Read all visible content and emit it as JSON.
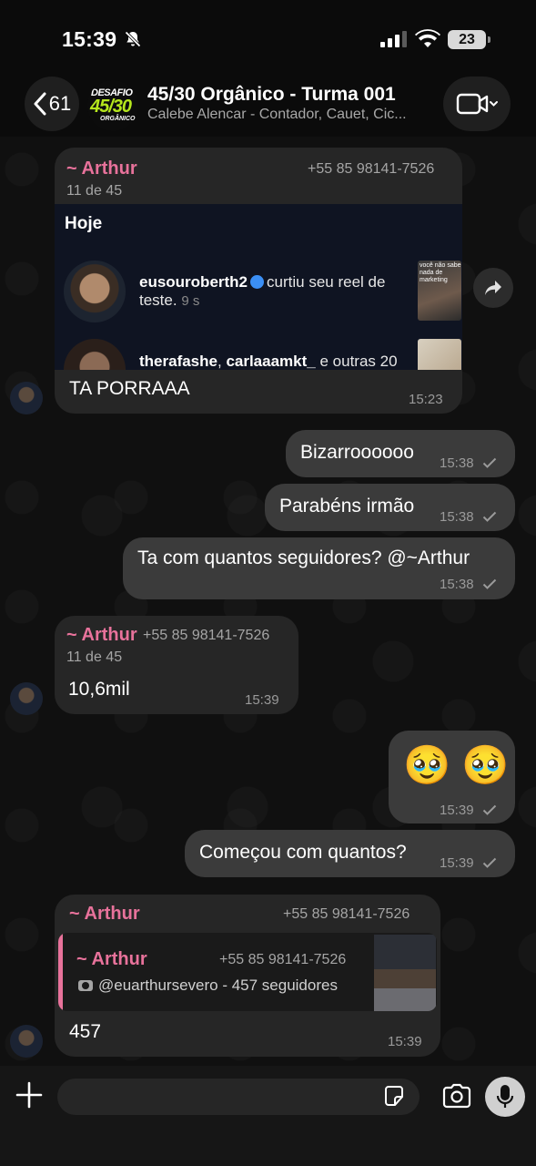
{
  "status_bar": {
    "time": "15:39",
    "battery": "23"
  },
  "header": {
    "back_count": "61",
    "group_logo_line1": "DESAFIO",
    "group_logo_line2": "45/30",
    "group_logo_line3": "ORGÂNICO",
    "title": "45/30 Orgânico - Turma 001",
    "subtitle": "Calebe Alencar - Contador, Cauet, Cic..."
  },
  "messages": [
    {
      "direction": "in",
      "sender": "~ Arthur",
      "phone": "+55 85 98141-7526",
      "subinfo": "11 de 45",
      "screenshot": {
        "heading": "Hoje",
        "user1": "eusouroberth2",
        "text1": "curtiu seu reel de",
        "text1b": "teste.",
        "age1": "9 s",
        "thumb1_caption": "você não sabe nada de marketing",
        "user2a": "therafashe",
        "user2b": "carlaaamkt_",
        "text2": "e outras 20"
      },
      "text": "TA PORRAAA",
      "time": "15:23"
    },
    {
      "direction": "out",
      "text": "Bizarroooooo",
      "time": "15:38"
    },
    {
      "direction": "out",
      "text": "Parabéns irmão",
      "time": "15:38"
    },
    {
      "direction": "out",
      "text": "Ta com quantos seguidores? @~Arthur",
      "time": "15:38"
    },
    {
      "direction": "in",
      "sender": "~ Arthur",
      "phone": "+55 85 98141-7526",
      "subinfo": "11 de 45",
      "text": "10,6mil",
      "time": "15:39"
    },
    {
      "direction": "out",
      "text": "🥹 🥹",
      "time": "15:39"
    },
    {
      "direction": "out",
      "text": "Começou com quantos?",
      "time": "15:39"
    },
    {
      "direction": "in",
      "sender": "~ Arthur",
      "phone": "+55 85 98141-7526",
      "quote": {
        "sender": "~ Arthur",
        "phone": "+55 85 98141-7526",
        "text": "@euarthursevero - 457 seguidores"
      },
      "text": "457",
      "time": "15:39"
    }
  ],
  "input": {
    "placeholder": ""
  },
  "icons": {
    "mute": "bell-slash-icon",
    "back": "chevron-left-icon",
    "video": "video-camera-icon",
    "forward": "share-forward-icon",
    "plus": "plus-icon",
    "sticker": "sticker-icon",
    "camera": "camera-icon",
    "mic": "microphone-icon"
  },
  "colors": {
    "sender_name": "#e8729b",
    "incoming_bubble": "#262626",
    "outgoing_bubble": "#3b3b3b"
  }
}
